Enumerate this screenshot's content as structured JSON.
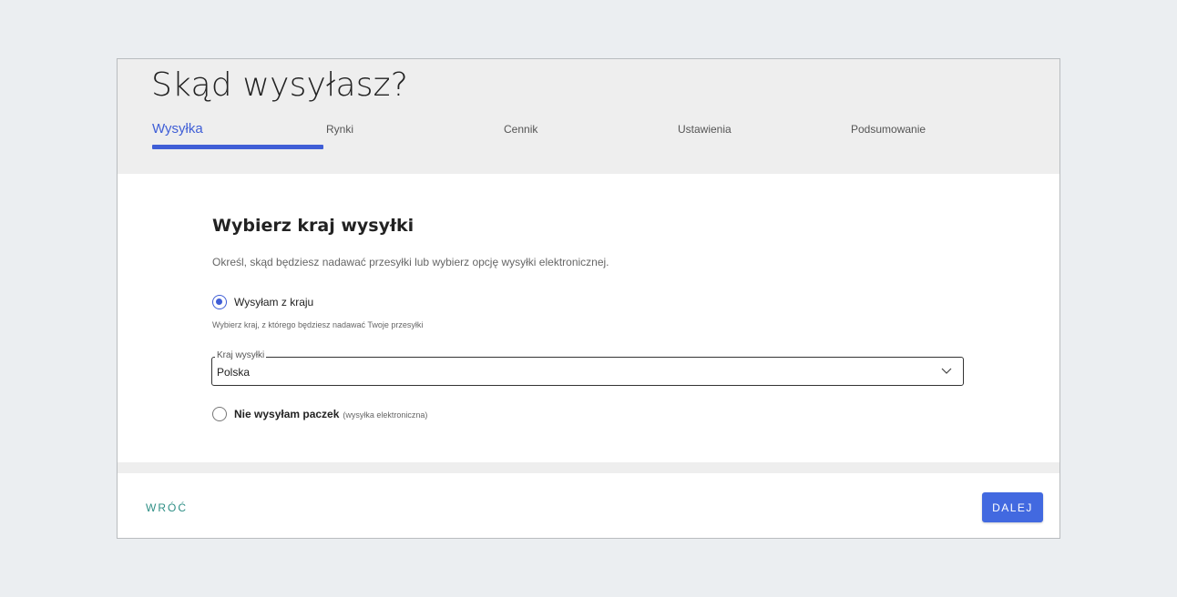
{
  "header": {
    "title": "Skąd wysyłasz?",
    "tabs": [
      {
        "label": "Wysyłka",
        "active": true
      },
      {
        "label": "Rynki",
        "active": false
      },
      {
        "label": "Cennik",
        "active": false
      },
      {
        "label": "Ustawienia",
        "active": false
      },
      {
        "label": "Podsumowanie",
        "active": false
      }
    ]
  },
  "section": {
    "title": "Wybierz kraj wysyłki",
    "description": "Określ, skąd będziesz nadawać przesyłki lub wybierz opcję wysyłki elektronicznej."
  },
  "options": {
    "domestic": {
      "label": "Wysyłam z kraju",
      "selected": true,
      "helper": "Wybierz kraj, z którego będziesz nadawać Twoje przesyłki"
    },
    "country_select": {
      "legend": "Kraj wysyłki",
      "value": "Polska"
    },
    "electronic": {
      "label": "Nie wysyłam paczek",
      "sublabel": "(wysyłka elektroniczna)",
      "selected": false
    }
  },
  "footer": {
    "back_label": "WRÓĆ",
    "next_label": "DALEJ"
  },
  "colors": {
    "accent": "#3f5ed6",
    "primary_button": "#4269e0",
    "back_link": "#2f8f86",
    "header_bg": "#eeeeee",
    "page_bg": "#ebeef1"
  },
  "icons": {
    "select_arrow": "chevron-down-icon"
  }
}
